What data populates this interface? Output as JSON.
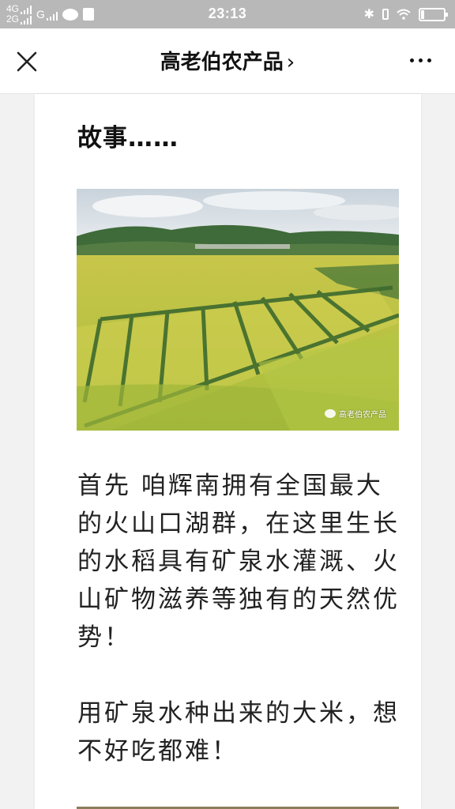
{
  "status_bar": {
    "network_top": "4G",
    "network_bottom": "2G",
    "network_g": "G",
    "time": "23:13",
    "icons": [
      "signal-icon",
      "wechat-icon",
      "bag-icon",
      "bluetooth-icon",
      "mini-battery-icon",
      "wifi-icon",
      "battery-icon"
    ],
    "battery_level": 0.12
  },
  "nav": {
    "title": "高老伯农产品",
    "title_chevron": "›",
    "close_icon": "close-icon",
    "more_icon": "more-icon"
  },
  "article": {
    "heading": "故事……",
    "photo_watermark": "高老伯农产品",
    "paragraph_1": "首先 咱辉南拥有全国最大的火山口湖群，在这里生长的水稻具有矿泉水灌溉、火山矿物滋养等独有的天然优势！",
    "paragraph_2": "用矿泉水种出来的大米，想不好吃都难！"
  },
  "colors": {
    "status_bar_bg": "#b8b8b8",
    "page_bg": "#f2f2f2",
    "card_bg": "#ffffff",
    "text": "#222222",
    "field_green": "#b9c23a"
  }
}
